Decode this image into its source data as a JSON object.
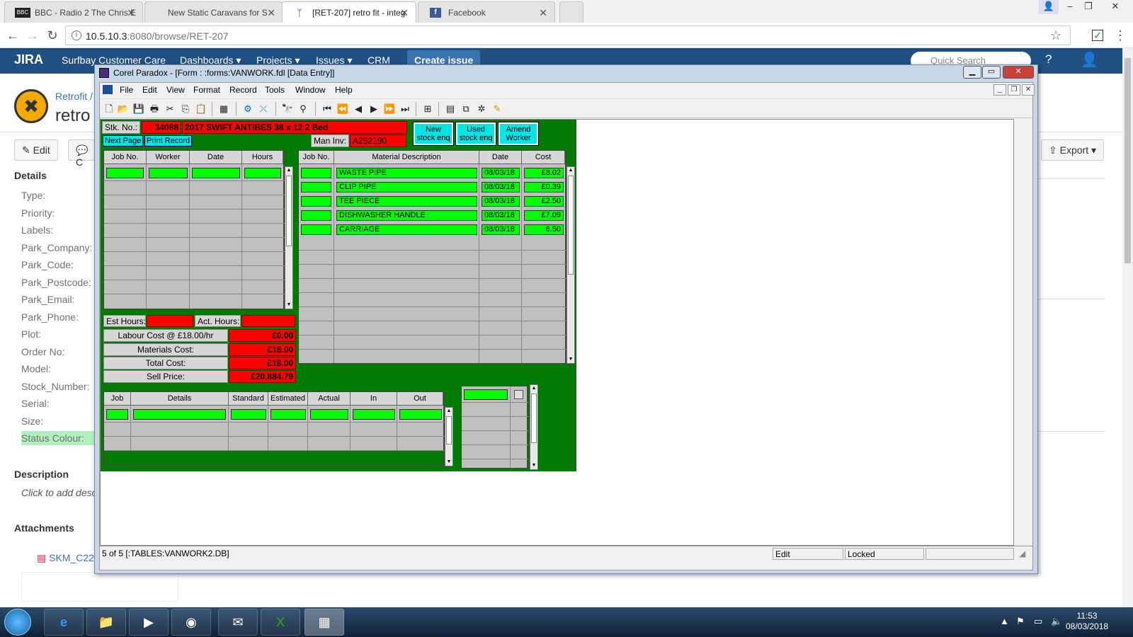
{
  "browser": {
    "tabs": [
      {
        "title": "BBC - Radio 2 The Chris E",
        "icon": "BBC"
      },
      {
        "title": "New Static Caravans for S",
        "icon": ""
      },
      {
        "title": "[RET-207] retro fit - integ",
        "icon": "jira-icon"
      },
      {
        "title": "Facebook",
        "icon": "f"
      }
    ],
    "url_host": "10.5.10.3",
    "url_rest": ":8080/browse/RET-207"
  },
  "jira": {
    "logo": "JIRA",
    "nav": [
      "Surfbay Customer Care",
      "Dashboards ▾",
      "Projects ▾",
      "Issues ▾",
      "CRM"
    ],
    "create": "Create issue",
    "search_placeholder": "Quick Search",
    "breadcrumb": "Retrofit /",
    "title": "retro",
    "edit_label": "Edit",
    "comment_label": "C",
    "export_label": "Export ▾",
    "details_heading": "Details",
    "fields": [
      "Type:",
      "Priority:",
      "Labels:",
      "Park_Company:",
      "Park_Code:",
      "Park_Postcode:",
      "Park_Email:",
      "Park_Phone:",
      "Plot:",
      "Order No:",
      "Model:",
      "Stock_Number:",
      "Serial:",
      "Size:",
      "Status Colour:"
    ],
    "description_heading": "Description",
    "description_placeholder": "Click to add desc",
    "attachments_heading": "Attachments",
    "attachment": "SKM_C22"
  },
  "paradox": {
    "title": "Corel Paradox - [Form : :forms:VANWORK.fdl [Data Entry]]",
    "menu": [
      "File",
      "Edit",
      "View",
      "Format",
      "Record",
      "Tools",
      "Window",
      "Help"
    ],
    "form": {
      "stk_label": "Stk. No.:",
      "stk_no": "34088",
      "stk_desc": "2017 SWIFT ANTIBES 38 x 12 2 Bed",
      "next_page": "Next Page",
      "print_record": "Print Record",
      "man_inv_label": "Man Inv:",
      "man_inv": "A252190",
      "btn_new": [
        "New",
        "stock enq"
      ],
      "btn_used": [
        "Used",
        "stock enq"
      ],
      "btn_amend": [
        "Amend",
        "Worker"
      ],
      "labour_headers": [
        "Job No.",
        "Worker",
        "Date",
        "Hours"
      ],
      "material_headers": [
        "Job No.",
        "Material Description",
        "Date",
        "Cost"
      ],
      "materials": [
        {
          "desc": "WASTE PIPE",
          "date": "08/03/18",
          "cost": "£8.02"
        },
        {
          "desc": "CLIP PIPE",
          "date": "08/03/18",
          "cost": "£0.39"
        },
        {
          "desc": "TEE PIECE",
          "date": "08/03/18",
          "cost": "£2.50"
        },
        {
          "desc": "DISHWASHER HANDLE",
          "date": "08/03/18",
          "cost": "£7.09"
        },
        {
          "desc": "CARRIAGE",
          "date": "08/03/18",
          "cost": "6.50"
        }
      ],
      "est_hours": "Est Hours:",
      "act_hours": "Act. Hours:",
      "labour_cost_label": "Labour Cost @ £18.00/hr",
      "labour_cost": "£0.00",
      "materials_cost_label": "Materials Cost:",
      "materials_cost": "£18.00",
      "total_cost_label": "Total Cost:",
      "total_cost": "£18.00",
      "sell_price_label": "Sell Price:",
      "sell_price": "£20,884.79",
      "job_headers": [
        "Job",
        "Details",
        "Standard",
        "Estimated",
        "Actual",
        "In",
        "Out"
      ]
    },
    "status": {
      "record": "5 of 5 [:TABLES:VANWORK2.DB]",
      "mode": "Edit",
      "lock": "Locked"
    }
  },
  "taskbar": {
    "time": "11:53",
    "date": "08/03/2018"
  }
}
